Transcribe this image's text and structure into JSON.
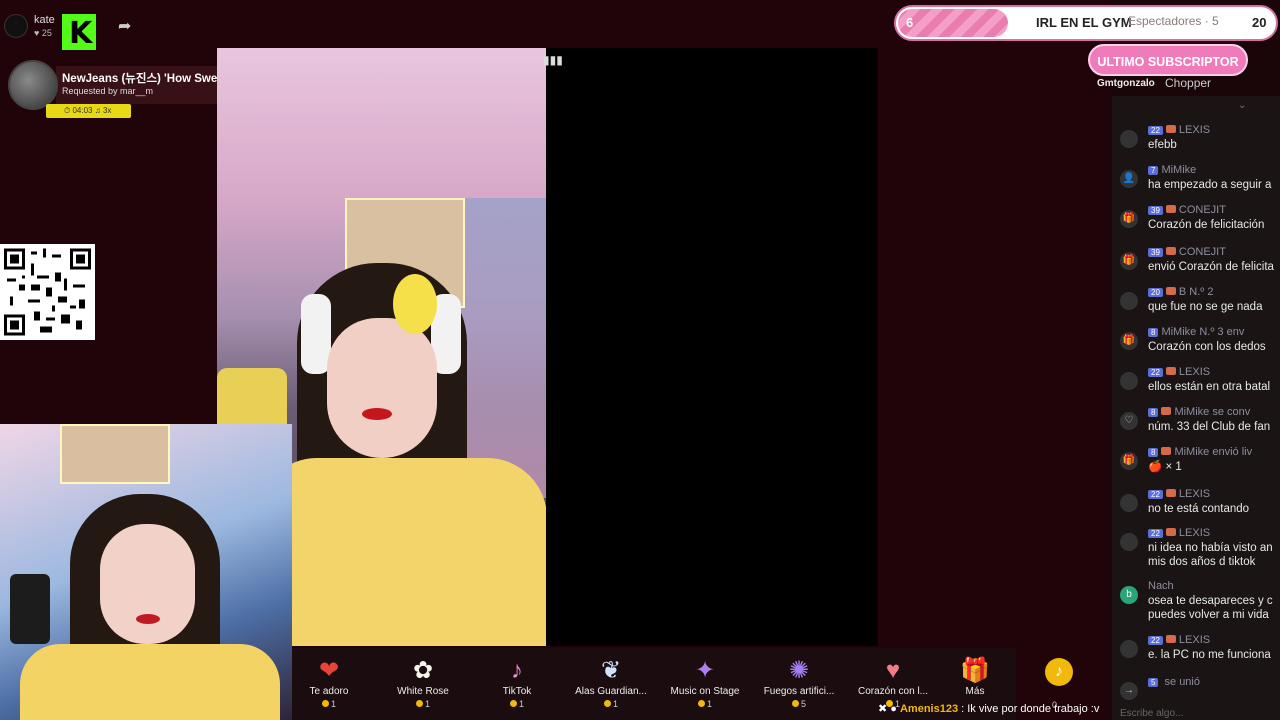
{
  "streamer": {
    "name": "kate",
    "likes": "25"
  },
  "now_playing": {
    "title": "NewJeans (뉴진스) 'How Sweet' Official MV",
    "requested_by": "Requested by mar__m",
    "duration": "04:03",
    "plays": "3x"
  },
  "goal": {
    "current": "6",
    "title": "IRL EN EL GYM",
    "target": "20"
  },
  "spectators": {
    "label": "Espectadores · 5"
  },
  "last_sub": {
    "label": "ULTIMO SUBSCRIPTOR",
    "name": "Gmtgonzalo",
    "name2": "Chopper"
  },
  "gifts": [
    {
      "icon": "❤",
      "name": "Te adoro",
      "price": "1"
    },
    {
      "icon": "✿",
      "name": "White Rose",
      "price": "1"
    },
    {
      "icon": "♪",
      "name": "TikTok",
      "price": "1"
    },
    {
      "icon": "❦",
      "name": "Alas Guardian...",
      "price": "1"
    },
    {
      "icon": "✦",
      "name": "Music on Stage",
      "price": "1"
    },
    {
      "icon": "✺",
      "name": "Fuegos artifici...",
      "price": "5"
    },
    {
      "icon": "♥",
      "name": "Corazón con l...",
      "price": "1"
    },
    {
      "icon": "🎁",
      "name": "Más",
      "price": ""
    }
  ],
  "coin_count": "0",
  "chat": [
    {
      "icon": "",
      "level": "22",
      "user": "LEXIS",
      "text": "efebb"
    },
    {
      "icon": "👤",
      "level": "7",
      "user": "MiMike",
      "text": "ha empezado a seguir a"
    },
    {
      "icon": "🎁",
      "level": "39",
      "user": "CONEJIT",
      "text": "Corazón de felicitación"
    },
    {
      "icon": "🎁",
      "level": "39",
      "user": "CONEJIT",
      "text": "envió Corazón de felicita"
    },
    {
      "icon": "",
      "level": "20",
      "user": "B  N.º 2",
      "text": "que fue no se ge nada"
    },
    {
      "icon": "🎁",
      "level": "8",
      "user": "MiMike  N.º 3  env",
      "text": "Corazón con los dedos"
    },
    {
      "icon": "",
      "level": "22",
      "user": "LEXIS",
      "text": "ellos están en otra batal"
    },
    {
      "icon": "♡",
      "level": "8",
      "user": "MiMike  se conv",
      "text": "núm. 33 del Club de fan"
    },
    {
      "icon": "🎁",
      "level": "8",
      "user": "MiMike envió liv",
      "text": "🍎 × 1"
    },
    {
      "icon": "",
      "level": "22",
      "user": "LEXIS",
      "text": "no te está contando"
    },
    {
      "icon": "",
      "level": "22",
      "user": "LEXIS",
      "text": "ni idea no había visto an"
    },
    {
      "icon": "b",
      "level": "",
      "user": "Nach",
      "text": "osea te desapareces y c"
    },
    {
      "icon": "",
      "level": "22",
      "user": "LEXIS",
      "text": "e. la PC no me funciona"
    },
    {
      "icon": "→",
      "level": "5",
      "user": "",
      "text": "se unió"
    }
  ],
  "chat_extra": {
    "m2b": "mis dos años d tiktok",
    "m12b": "puedes volver a mi vida"
  },
  "chat_placeholder": "Escribe algo...",
  "ticker": {
    "name": "Amenis123",
    "text": "Ik vive por donde trabajo :v"
  }
}
